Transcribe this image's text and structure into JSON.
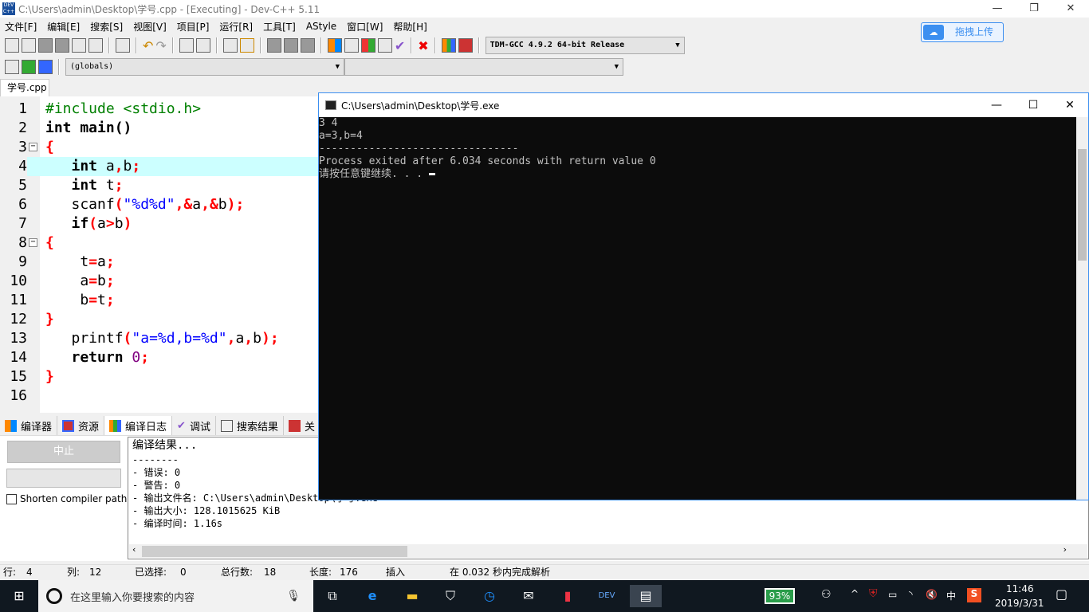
{
  "window": {
    "title": "C:\\Users\\admin\\Desktop\\学号.cpp - [Executing] - Dev-C++ 5.11",
    "minimize": "—",
    "restore": "❐",
    "close": "✕",
    "app_icon": "DEV C++"
  },
  "menu": [
    "文件[F]",
    "编辑[E]",
    "搜索[S]",
    "视图[V]",
    "项目[P]",
    "运行[R]",
    "工具[T]",
    "AStyle",
    "窗口[W]",
    "帮助[H]"
  ],
  "toolbar": {
    "compiler": "TDM-GCC 4.9.2 64-bit Release",
    "scope": "(globals)",
    "symbol": ""
  },
  "upload_button": {
    "label": "拖拽上传",
    "icon": "cloud-icon"
  },
  "file_tab": "学号.cpp",
  "editor": {
    "highlight_line": 4,
    "lines": [
      [
        [
          "#include <stdio.h>",
          "p"
        ]
      ],
      [
        [
          "int main()",
          "k"
        ]
      ],
      [
        [
          "{",
          "r"
        ]
      ],
      [
        [
          "   int ",
          "k"
        ],
        [
          "a",
          "i"
        ],
        [
          ",",
          "r"
        ],
        [
          "b",
          "i"
        ],
        [
          ";",
          "r"
        ]
      ],
      [
        [
          "   int ",
          "k"
        ],
        [
          "t",
          "i"
        ],
        [
          ";",
          "r"
        ]
      ],
      [
        [
          "   scanf",
          "i"
        ],
        [
          "(",
          "r"
        ],
        [
          "\"%d%d\"",
          "s"
        ],
        [
          ",&",
          "r"
        ],
        [
          "a",
          "i"
        ],
        [
          ",&",
          "r"
        ],
        [
          "b",
          "i"
        ],
        [
          ");",
          "r"
        ]
      ],
      [
        [
          "   if",
          "k"
        ],
        [
          "(",
          "r"
        ],
        [
          "a",
          "i"
        ],
        [
          ">",
          "r"
        ],
        [
          "b",
          "i"
        ],
        [
          ")",
          "r"
        ]
      ],
      [
        [
          "{",
          "r"
        ]
      ],
      [
        [
          "    t",
          "i"
        ],
        [
          "=",
          "r"
        ],
        [
          "a",
          "i"
        ],
        [
          ";",
          "r"
        ]
      ],
      [
        [
          "    a",
          "i"
        ],
        [
          "=",
          "r"
        ],
        [
          "b",
          "i"
        ],
        [
          ";",
          "r"
        ]
      ],
      [
        [
          "    b",
          "i"
        ],
        [
          "=",
          "r"
        ],
        [
          "t",
          "i"
        ],
        [
          ";",
          "r"
        ]
      ],
      [
        [
          "}",
          "r"
        ]
      ],
      [
        [
          "   printf",
          "i"
        ],
        [
          "(",
          "r"
        ],
        [
          "\"a=%d,b=%d\"",
          "s"
        ],
        [
          ",",
          "r"
        ],
        [
          "a",
          "i"
        ],
        [
          ",",
          "r"
        ],
        [
          "b",
          "i"
        ],
        [
          ");",
          "r"
        ]
      ],
      [
        [
          "   return ",
          "k"
        ],
        [
          "0",
          "n"
        ],
        [
          ";",
          "r"
        ]
      ],
      [
        [
          "}",
          "r"
        ]
      ],
      [
        [
          "",
          "i"
        ]
      ]
    ],
    "fold_lines": [
      3,
      8
    ]
  },
  "bottom_tabs": [
    {
      "label": "编译器",
      "icon": "compiler-icon"
    },
    {
      "label": "资源",
      "icon": "resources-icon"
    },
    {
      "label": "编译日志",
      "icon": "compile-log-icon"
    },
    {
      "label": "调试",
      "icon": "debug-icon"
    },
    {
      "label": "搜索结果",
      "icon": "search-results-icon"
    },
    {
      "label": "关",
      "icon": "close-tab-icon"
    }
  ],
  "compile": {
    "abort": "中止",
    "shorten": "Shorten compiler paths",
    "log": [
      "编译结果...",
      "--------",
      "- 错误: 0",
      "- 警告: 0",
      "- 输出文件名: C:\\Users\\admin\\Desktop\\学号.exe",
      "- 输出大小: 128.1015625 KiB",
      "- 编译时间: 1.16s"
    ]
  },
  "status": {
    "row_label": "行:",
    "row": "4",
    "col_label": "列:",
    "col": "12",
    "sel_label": "已选择:",
    "sel": "0",
    "total_label": "总行数:",
    "total": "18",
    "len_label": "长度:",
    "len": "176",
    "mode": "插入",
    "parse": "在 0.032 秒内完成解析"
  },
  "console": {
    "title": "C:\\Users\\admin\\Desktop\\学号.exe",
    "lines": [
      "3 4",
      "a=3,b=4",
      "--------------------------------",
      "Process exited after 6.034 seconds with return value 0",
      "请按任意键继续. . . "
    ]
  },
  "taskbar": {
    "search_placeholder": "在这里输入你要搜索的内容",
    "battery": "93%",
    "ime": "中",
    "time": "11:46",
    "date": "2019/3/31"
  }
}
